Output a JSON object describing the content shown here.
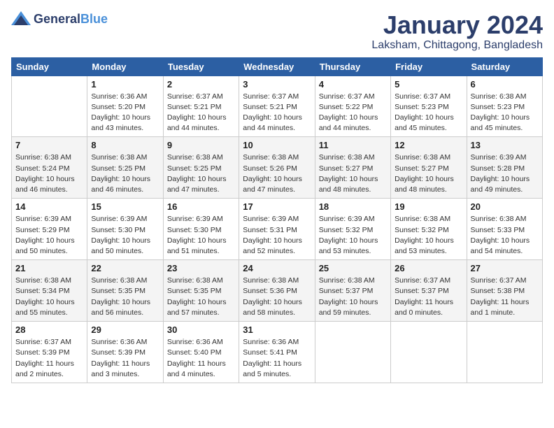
{
  "logo": {
    "line1": "General",
    "line2": "Blue"
  },
  "title": "January 2024",
  "subtitle": "Laksham, Chittagong, Bangladesh",
  "headers": [
    "Sunday",
    "Monday",
    "Tuesday",
    "Wednesday",
    "Thursday",
    "Friday",
    "Saturday"
  ],
  "weeks": [
    [
      {
        "num": "",
        "sunrise": "",
        "sunset": "",
        "daylight": ""
      },
      {
        "num": "1",
        "sunrise": "Sunrise: 6:36 AM",
        "sunset": "Sunset: 5:20 PM",
        "daylight": "Daylight: 10 hours and 43 minutes."
      },
      {
        "num": "2",
        "sunrise": "Sunrise: 6:37 AM",
        "sunset": "Sunset: 5:21 PM",
        "daylight": "Daylight: 10 hours and 44 minutes."
      },
      {
        "num": "3",
        "sunrise": "Sunrise: 6:37 AM",
        "sunset": "Sunset: 5:21 PM",
        "daylight": "Daylight: 10 hours and 44 minutes."
      },
      {
        "num": "4",
        "sunrise": "Sunrise: 6:37 AM",
        "sunset": "Sunset: 5:22 PM",
        "daylight": "Daylight: 10 hours and 44 minutes."
      },
      {
        "num": "5",
        "sunrise": "Sunrise: 6:37 AM",
        "sunset": "Sunset: 5:23 PM",
        "daylight": "Daylight: 10 hours and 45 minutes."
      },
      {
        "num": "6",
        "sunrise": "Sunrise: 6:38 AM",
        "sunset": "Sunset: 5:23 PM",
        "daylight": "Daylight: 10 hours and 45 minutes."
      }
    ],
    [
      {
        "num": "7",
        "sunrise": "Sunrise: 6:38 AM",
        "sunset": "Sunset: 5:24 PM",
        "daylight": "Daylight: 10 hours and 46 minutes."
      },
      {
        "num": "8",
        "sunrise": "Sunrise: 6:38 AM",
        "sunset": "Sunset: 5:25 PM",
        "daylight": "Daylight: 10 hours and 46 minutes."
      },
      {
        "num": "9",
        "sunrise": "Sunrise: 6:38 AM",
        "sunset": "Sunset: 5:25 PM",
        "daylight": "Daylight: 10 hours and 47 minutes."
      },
      {
        "num": "10",
        "sunrise": "Sunrise: 6:38 AM",
        "sunset": "Sunset: 5:26 PM",
        "daylight": "Daylight: 10 hours and 47 minutes."
      },
      {
        "num": "11",
        "sunrise": "Sunrise: 6:38 AM",
        "sunset": "Sunset: 5:27 PM",
        "daylight": "Daylight: 10 hours and 48 minutes."
      },
      {
        "num": "12",
        "sunrise": "Sunrise: 6:38 AM",
        "sunset": "Sunset: 5:27 PM",
        "daylight": "Daylight: 10 hours and 48 minutes."
      },
      {
        "num": "13",
        "sunrise": "Sunrise: 6:39 AM",
        "sunset": "Sunset: 5:28 PM",
        "daylight": "Daylight: 10 hours and 49 minutes."
      }
    ],
    [
      {
        "num": "14",
        "sunrise": "Sunrise: 6:39 AM",
        "sunset": "Sunset: 5:29 PM",
        "daylight": "Daylight: 10 hours and 50 minutes."
      },
      {
        "num": "15",
        "sunrise": "Sunrise: 6:39 AM",
        "sunset": "Sunset: 5:30 PM",
        "daylight": "Daylight: 10 hours and 50 minutes."
      },
      {
        "num": "16",
        "sunrise": "Sunrise: 6:39 AM",
        "sunset": "Sunset: 5:30 PM",
        "daylight": "Daylight: 10 hours and 51 minutes."
      },
      {
        "num": "17",
        "sunrise": "Sunrise: 6:39 AM",
        "sunset": "Sunset: 5:31 PM",
        "daylight": "Daylight: 10 hours and 52 minutes."
      },
      {
        "num": "18",
        "sunrise": "Sunrise: 6:39 AM",
        "sunset": "Sunset: 5:32 PM",
        "daylight": "Daylight: 10 hours and 53 minutes."
      },
      {
        "num": "19",
        "sunrise": "Sunrise: 6:38 AM",
        "sunset": "Sunset: 5:32 PM",
        "daylight": "Daylight: 10 hours and 53 minutes."
      },
      {
        "num": "20",
        "sunrise": "Sunrise: 6:38 AM",
        "sunset": "Sunset: 5:33 PM",
        "daylight": "Daylight: 10 hours and 54 minutes."
      }
    ],
    [
      {
        "num": "21",
        "sunrise": "Sunrise: 6:38 AM",
        "sunset": "Sunset: 5:34 PM",
        "daylight": "Daylight: 10 hours and 55 minutes."
      },
      {
        "num": "22",
        "sunrise": "Sunrise: 6:38 AM",
        "sunset": "Sunset: 5:35 PM",
        "daylight": "Daylight: 10 hours and 56 minutes."
      },
      {
        "num": "23",
        "sunrise": "Sunrise: 6:38 AM",
        "sunset": "Sunset: 5:35 PM",
        "daylight": "Daylight: 10 hours and 57 minutes."
      },
      {
        "num": "24",
        "sunrise": "Sunrise: 6:38 AM",
        "sunset": "Sunset: 5:36 PM",
        "daylight": "Daylight: 10 hours and 58 minutes."
      },
      {
        "num": "25",
        "sunrise": "Sunrise: 6:38 AM",
        "sunset": "Sunset: 5:37 PM",
        "daylight": "Daylight: 10 hours and 59 minutes."
      },
      {
        "num": "26",
        "sunrise": "Sunrise: 6:37 AM",
        "sunset": "Sunset: 5:37 PM",
        "daylight": "Daylight: 11 hours and 0 minutes."
      },
      {
        "num": "27",
        "sunrise": "Sunrise: 6:37 AM",
        "sunset": "Sunset: 5:38 PM",
        "daylight": "Daylight: 11 hours and 1 minute."
      }
    ],
    [
      {
        "num": "28",
        "sunrise": "Sunrise: 6:37 AM",
        "sunset": "Sunset: 5:39 PM",
        "daylight": "Daylight: 11 hours and 2 minutes."
      },
      {
        "num": "29",
        "sunrise": "Sunrise: 6:36 AM",
        "sunset": "Sunset: 5:39 PM",
        "daylight": "Daylight: 11 hours and 3 minutes."
      },
      {
        "num": "30",
        "sunrise": "Sunrise: 6:36 AM",
        "sunset": "Sunset: 5:40 PM",
        "daylight": "Daylight: 11 hours and 4 minutes."
      },
      {
        "num": "31",
        "sunrise": "Sunrise: 6:36 AM",
        "sunset": "Sunset: 5:41 PM",
        "daylight": "Daylight: 11 hours and 5 minutes."
      },
      {
        "num": "",
        "sunrise": "",
        "sunset": "",
        "daylight": ""
      },
      {
        "num": "",
        "sunrise": "",
        "sunset": "",
        "daylight": ""
      },
      {
        "num": "",
        "sunrise": "",
        "sunset": "",
        "daylight": ""
      }
    ]
  ]
}
